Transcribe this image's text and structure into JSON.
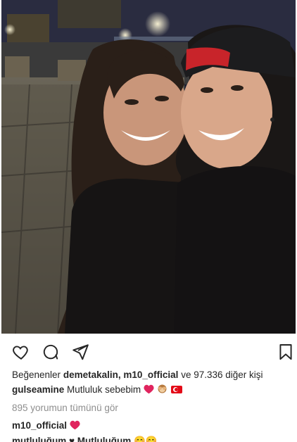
{
  "post": {
    "likes_prefix": "Beğenenler",
    "liker_name": "demetakalin,",
    "liker_name_2": "m10_official",
    "likes_suffix": "ve 97.336 diğer kişi",
    "caption_user": "gulseamine",
    "caption_text": "Mutluluk sebebim",
    "view_comments": "895 yorumun tümünü gör",
    "comment_user": "m10_official",
    "partial_line": "mutluluğum ♥ Mutluluğum 😊😊"
  },
  "icons": {
    "like": "heart-outline-icon",
    "comment": "comment-bubble-icon",
    "share": "send-paper-plane-icon",
    "save": "bookmark-icon",
    "heart_red": "#e0245e"
  }
}
